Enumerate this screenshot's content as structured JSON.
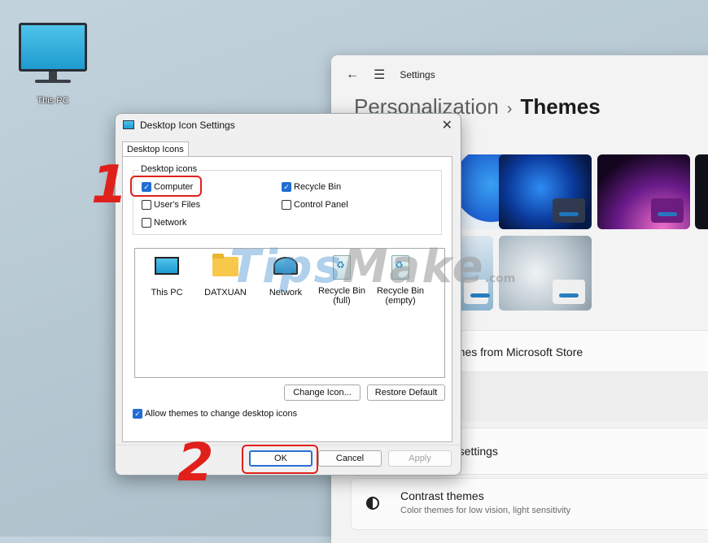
{
  "desktop": {
    "this_pc_label": "This PC"
  },
  "settings": {
    "back_icon": "arrow-left-icon",
    "menu_icon": "hamburger-icon",
    "app_name": "Settings",
    "breadcrumb_parent": "Personalization",
    "breadcrumb_sep": "›",
    "breadcrumb_current": "Themes",
    "store_link": "emes from Microsoft Store",
    "settings_row": "n settings",
    "contrast_title": "Contrast themes",
    "contrast_desc": "Color themes for low vision, light sensitivity"
  },
  "dialog": {
    "title": "Desktop Icon Settings",
    "close": "✕",
    "tab": "Desktop Icons",
    "group_legend": "Desktop icons",
    "checkboxes": [
      {
        "label": "Computer",
        "checked": true
      },
      {
        "label": "Recycle Bin",
        "checked": true
      },
      {
        "label": "User's Files",
        "checked": false
      },
      {
        "label": "Control Panel",
        "checked": false
      },
      {
        "label": "Network",
        "checked": false
      }
    ],
    "icons": [
      {
        "label": "This PC",
        "icon": "monitor-icon"
      },
      {
        "label": "DATXUAN",
        "icon": "folder-icon"
      },
      {
        "label": "Network",
        "icon": "network-icon"
      },
      {
        "label": "Recycle Bin (full)",
        "icon": "recycle-bin-full-icon"
      },
      {
        "label": "Recycle Bin (empty)",
        "icon": "recycle-bin-empty-icon"
      }
    ],
    "change_icon": "Change Icon...",
    "restore_default": "Restore Default",
    "allow_themes": "Allow themes to change desktop icons",
    "allow_themes_checked": true,
    "ok": "OK",
    "cancel": "Cancel",
    "apply": "Apply"
  },
  "annotations": {
    "step1": "1",
    "step2": "2",
    "color": "#e0201b"
  },
  "watermark": {
    "text_a": "Tips",
    "text_b": "Make",
    "domain": ".com"
  }
}
